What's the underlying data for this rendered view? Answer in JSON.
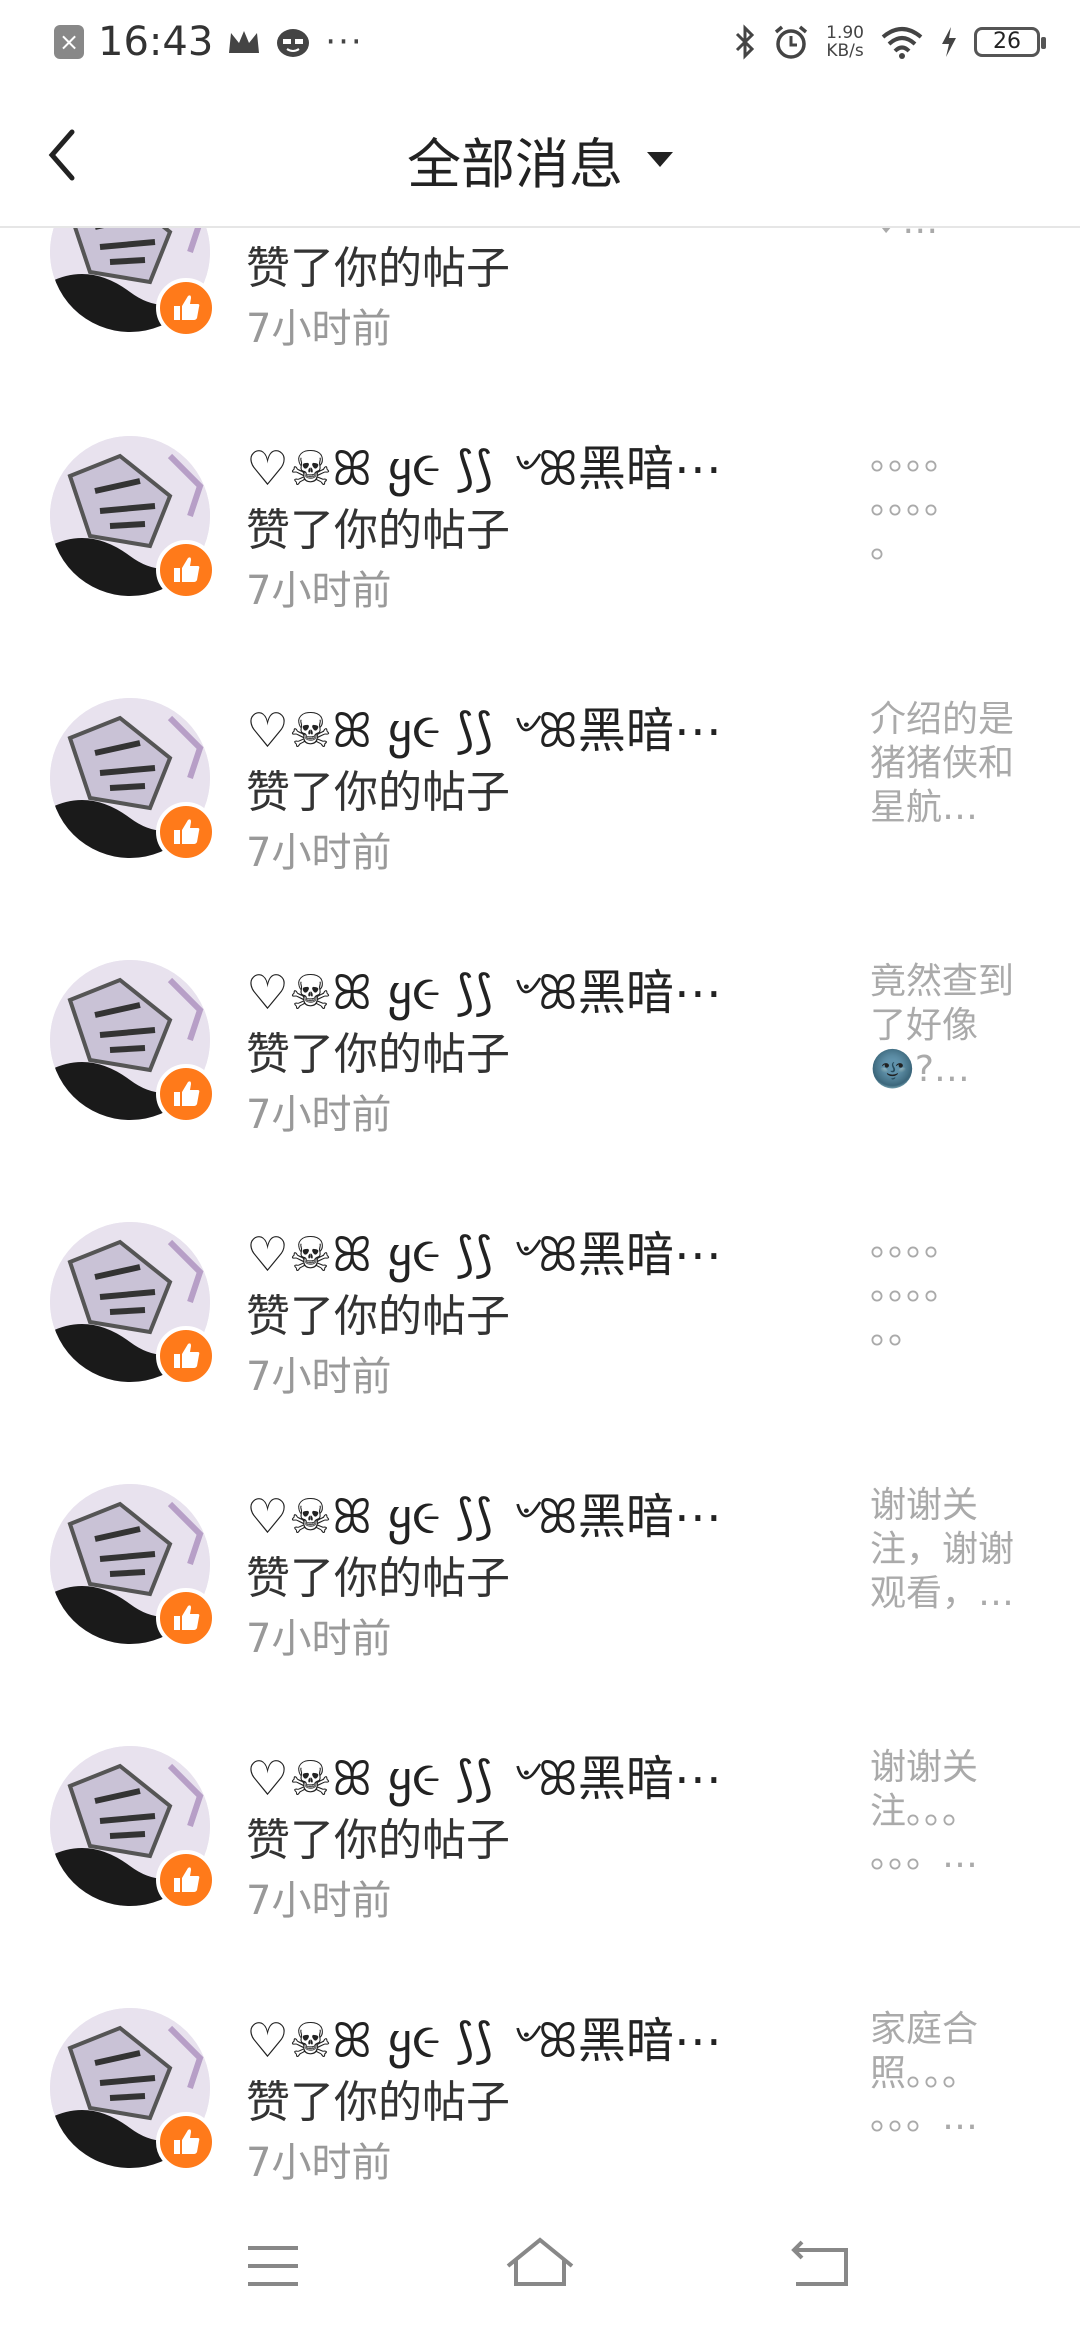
{
  "status_bar": {
    "time": "16:43",
    "icons": [
      "close-notification-icon",
      "crown-icon",
      "emoji-icon",
      "more-dots-icon",
      "bluetooth-icon",
      "alarm-icon",
      "wifi-icon",
      "charging-icon",
      "battery-icon"
    ],
    "more": "···",
    "net_speed": "1.90",
    "net_unit": "KB/s",
    "battery": "26"
  },
  "header": {
    "title": "全部消息",
    "back_icon": "back-chevron-icon",
    "dropdown_icon": "caret-down-icon"
  },
  "notifications": [
    {
      "name": "",
      "action": "赞了你的帖子",
      "time": "7小时前",
      "preview": "了❤️❤️\n♥…"
    },
    {
      "name": "♡☠ꕤ ყ૯ ⟆⟆ ৺ꕤ黑暗⋯",
      "action": "赞了你的帖子",
      "time": "7小时前",
      "preview": "。。。。\n。。。。\n。"
    },
    {
      "name": "♡☠ꕤ ყ૯ ⟆⟆ ৺ꕤ黑暗⋯",
      "action": "赞了你的帖子",
      "time": "7小时前",
      "preview": "介绍的是\n猪猪侠和\n星航…"
    },
    {
      "name": "♡☠ꕤ ყ૯ ⟆⟆ ৺ꕤ黑暗⋯",
      "action": "赞了你的帖子",
      "time": "7小时前",
      "preview": "竟然查到\n了好像\n🌚?…"
    },
    {
      "name": "♡☠ꕤ ყ૯ ⟆⟆ ৺ꕤ黑暗⋯",
      "action": "赞了你的帖子",
      "time": "7小时前",
      "preview": "。。。。\n。。。。\n。。"
    },
    {
      "name": "♡☠ꕤ ყ૯ ⟆⟆ ৺ꕤ黑暗⋯",
      "action": "赞了你的帖子",
      "time": "7小时前",
      "preview": "谢谢关\n注，谢谢\n观看，…"
    },
    {
      "name": "♡☠ꕤ ყ૯ ⟆⟆ ৺ꕤ黑暗⋯",
      "action": "赞了你的帖子",
      "time": "7小时前",
      "preview": "谢谢关\n注。。。\n。。。…"
    },
    {
      "name": "♡☠ꕤ ყ૯ ⟆⟆ ৺ꕤ黑暗⋯",
      "action": "赞了你的帖子",
      "time": "7小时前",
      "preview": "家庭合\n照。。。\n。。。…"
    }
  ],
  "nav_bar": {
    "menu_icon": "menu-icon",
    "home_icon": "home-icon",
    "back_icon": "return-icon"
  },
  "colors": {
    "like_badge": "#ff7a1a",
    "time_text": "#999999",
    "preview_text": "#aaaaaa"
  }
}
